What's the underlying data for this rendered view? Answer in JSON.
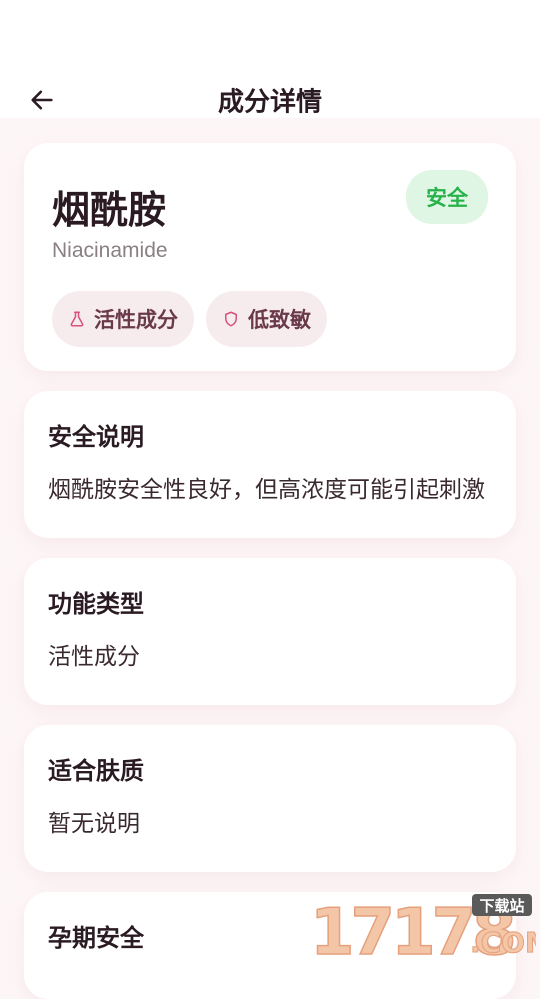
{
  "header": {
    "title": "成分详情"
  },
  "ingredient": {
    "name": "烟酰胺",
    "english_name": "Niacinamide",
    "safety_label": "安全",
    "tags": [
      {
        "label": "活性成分",
        "icon": "flask-icon"
      },
      {
        "label": "低致敏",
        "icon": "shield-icon"
      }
    ]
  },
  "sections": [
    {
      "title": "安全说明",
      "body": "烟酰胺安全性良好，但高浓度可能引起刺激"
    },
    {
      "title": "功能类型",
      "body": "活性成分"
    },
    {
      "title": "适合肤质",
      "body": "暂无说明"
    },
    {
      "title": "孕期安全",
      "body": ""
    }
  ],
  "watermark": {
    "text": "17178",
    "sub": "下载站",
    "domain": ".COM"
  },
  "colors": {
    "safe_bg": "#dff6e4",
    "safe_text": "#27b24a",
    "tag_bg": "#f6ecee",
    "tag_icon": "#d9507a",
    "page_bg": "#fdf6f7"
  }
}
